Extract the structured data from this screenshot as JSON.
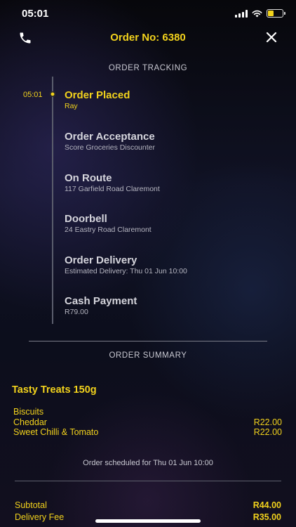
{
  "status_bar": {
    "time": "05:01"
  },
  "header": {
    "order_title": "Order No: 6380"
  },
  "tracking": {
    "section_title": "ORDER TRACKING",
    "current_time": "05:01",
    "steps": [
      {
        "title": "Order Placed",
        "sub": "Ray"
      },
      {
        "title": "Order Acceptance",
        "sub": "Score Groceries Discounter"
      },
      {
        "title": "On Route",
        "sub": "117  Garfield Road  Claremont"
      },
      {
        "title": "Doorbell",
        "sub": "24  Eastry Road  Claremont"
      },
      {
        "title": "Order Delivery",
        "sub": "Estimated Delivery: Thu 01 Jun  10:00"
      },
      {
        "title": "Cash Payment",
        "sub": "R79.00"
      }
    ]
  },
  "summary": {
    "section_title": "ORDER SUMMARY",
    "product_title": "Tasty Treats 150g",
    "category": "Biscuits",
    "items": [
      {
        "name": "Cheddar",
        "price": "R22.00"
      },
      {
        "name": "Sweet Chilli & Tomato",
        "price": "R22.00"
      }
    ],
    "schedule_text": "Order scheduled for Thu 01 Jun  10:00",
    "totals": [
      {
        "label": "Subtotal",
        "amount": "R44.00"
      },
      {
        "label": "Delivery Fee",
        "amount": "R35.00"
      }
    ]
  },
  "colors": {
    "accent": "#f2d21c",
    "text": "#d5d5dc",
    "muted": "#b5b5c0"
  }
}
